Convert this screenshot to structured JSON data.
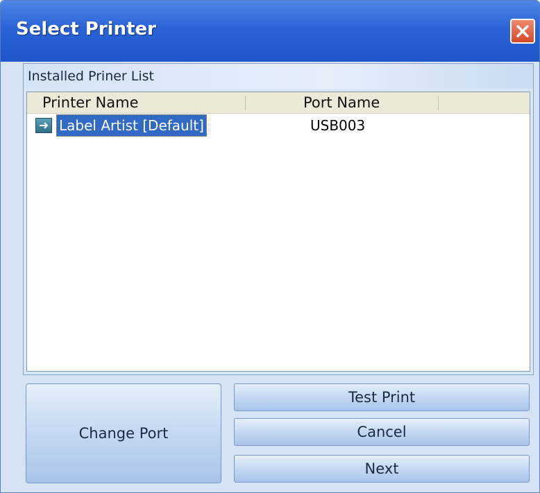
{
  "window": {
    "title": "Select Printer",
    "close_icon": "close-icon"
  },
  "group": {
    "label": "Installed Priner List"
  },
  "list": {
    "columns": [
      "Printer Name",
      "Port Name"
    ],
    "rows": [
      {
        "icon": "arrow-right-icon",
        "printer_name": "Label Artist [Default]",
        "port_name": "USB003",
        "selected": true
      }
    ]
  },
  "buttons": {
    "change_port": "Change Port",
    "test_print": "Test Print",
    "cancel": "Cancel",
    "next": "Next"
  },
  "colors": {
    "titlebar": "#2a63d6",
    "selection": "#316ac5",
    "close_button": "#d24a2a"
  }
}
